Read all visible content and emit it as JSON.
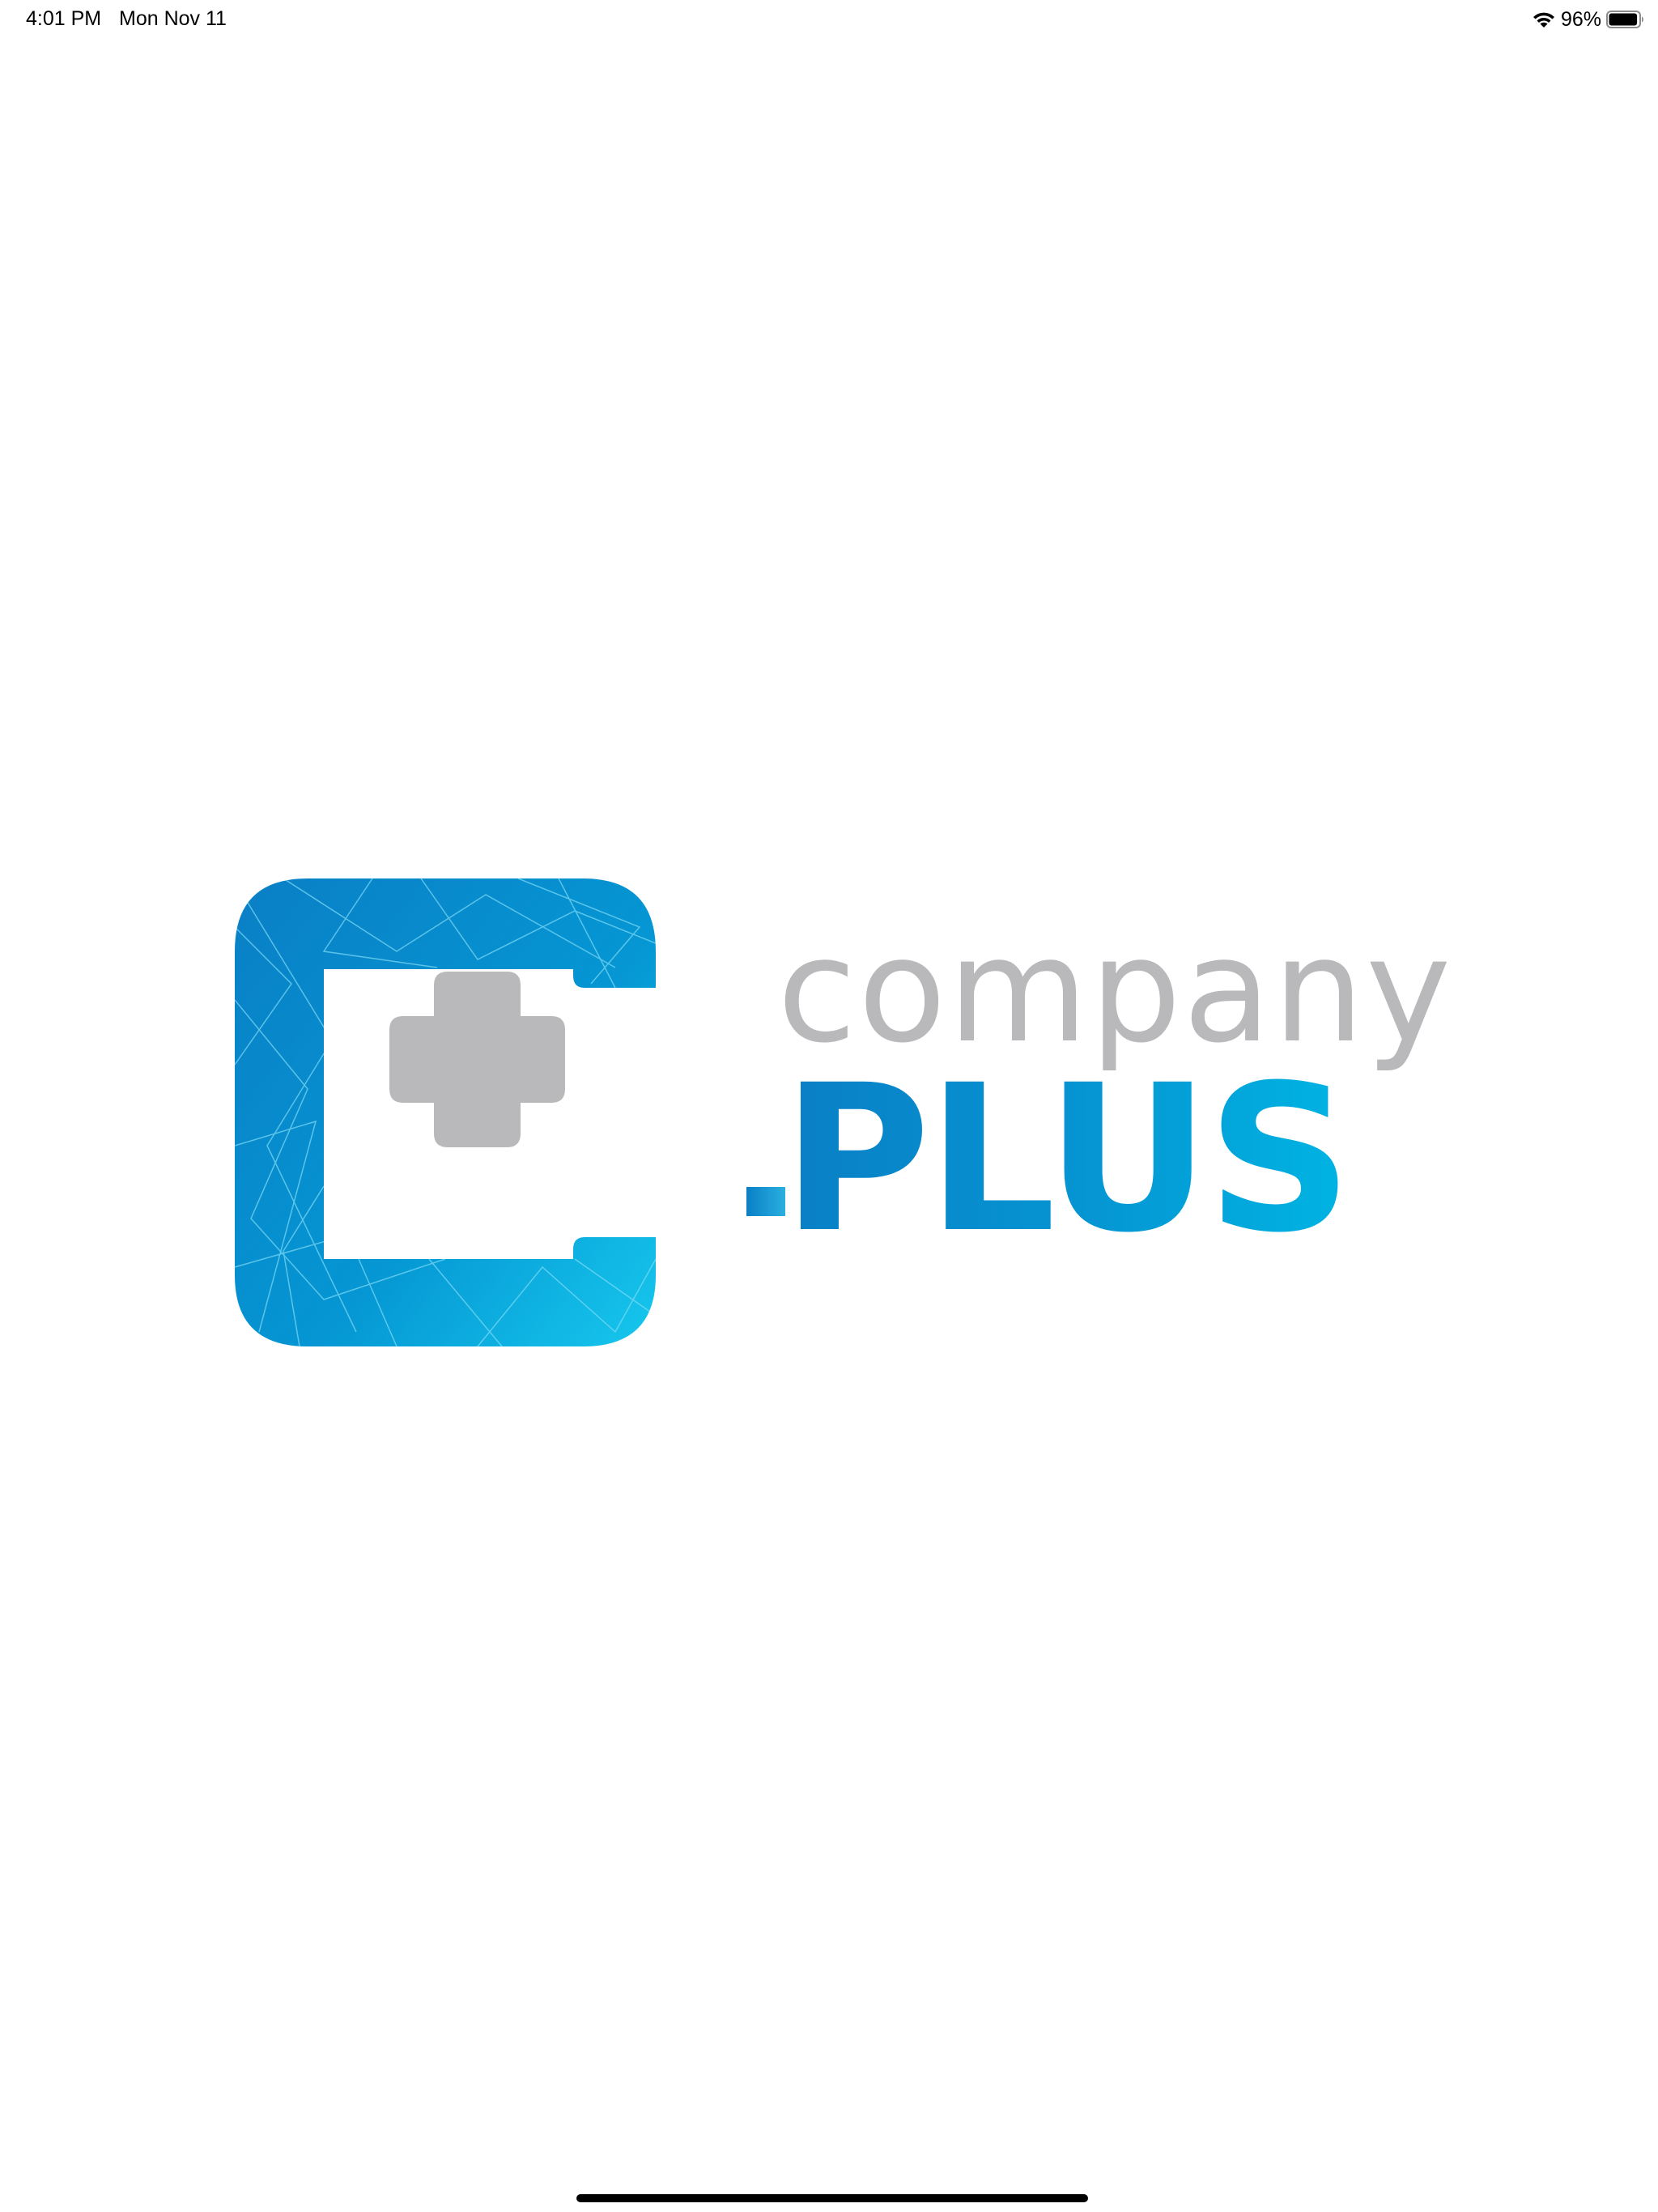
{
  "status_bar": {
    "time": "4:01 PM",
    "date": "Mon Nov 11",
    "battery_percent": "96%",
    "battery_level": 0.96,
    "icons": [
      "wifi-icon",
      "battery-icon"
    ]
  },
  "logo": {
    "word_top": "company",
    "word_bottom": "PLUS",
    "colors": {
      "blue_dark": "#0a7fc6",
      "blue_light": "#00b4e3",
      "gray": "#b9b9bb"
    }
  }
}
